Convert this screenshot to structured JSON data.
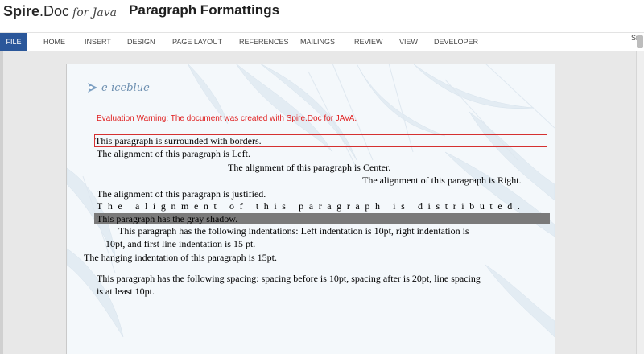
{
  "app": {
    "brand_bold": "Spire",
    "brand_doc": ".Doc",
    "brand_for": "for Java",
    "title": "Paragraph Formattings"
  },
  "ribbon": {
    "tabs": [
      "FILE",
      "HOME",
      "INSERT",
      "DESIGN",
      "PAGE LAYOUT",
      "REFERENCES",
      "MAILINGS",
      "REVIEW",
      "VIEW",
      "DEVELOPER"
    ],
    "signin_partial": "Sig"
  },
  "document": {
    "logo_text": "e-iceblue",
    "warning": "Evaluation Warning: The document was created with Spire.Doc for JAVA.",
    "paragraphs": {
      "bordered": "This paragraph is surrounded with borders.",
      "left": "The alignment of this paragraph is Left.",
      "center": "The alignment of this paragraph is Center.",
      "right": "The alignment of this paragraph is Right.",
      "justified": "The alignment of this paragraph is justified.",
      "distributed": "The alignment of this paragraph is distributed.",
      "shadow": "This paragraph has the gray shadow.",
      "indent_line1": "This paragraph has the following indentations: Left indentation is 10pt, right indentation is",
      "indent_line2": "10pt, and first line indentation is 15 pt.",
      "hanging": "The hanging indentation of this paragraph is 15pt.",
      "spacing_line1": "This paragraph has the following spacing: spacing before is 10pt, spacing after is 20pt, line spacing",
      "spacing_line2": "is at least 10pt."
    }
  },
  "colors": {
    "file_tab": "#2b579a",
    "warning": "#e02020",
    "border": "#d53030",
    "shadow": "#7a7a7a"
  }
}
